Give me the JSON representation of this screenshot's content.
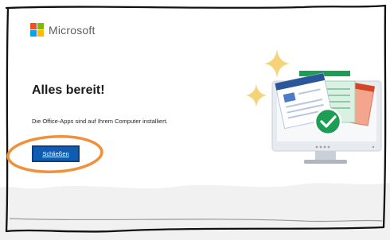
{
  "brand": {
    "name": "Microsoft",
    "logo_colors": [
      "#f25022",
      "#7fba00",
      "#00a4ef",
      "#ffb900"
    ]
  },
  "main": {
    "title": "Alles bereit!",
    "message": "Die Office-Apps sind auf Ihrem Computer installiert.",
    "close_label": "Schließen"
  },
  "colors": {
    "accent": "#0f5db3",
    "annotation": "#f0913a",
    "check": "#1e9e55"
  }
}
